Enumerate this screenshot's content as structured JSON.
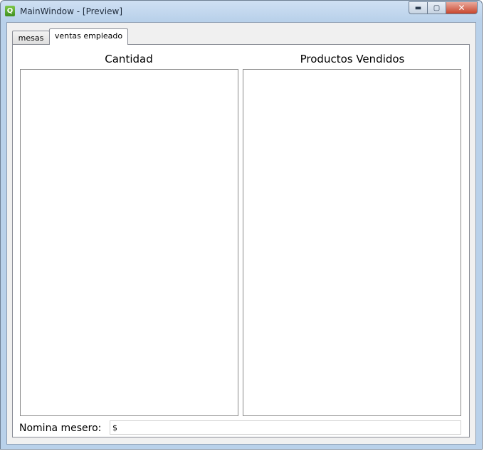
{
  "window": {
    "title": "MainWindow - [Preview]",
    "app_icon": "qt-designer-icon",
    "controls": {
      "minimize": "minimize-icon",
      "maximize": "maximize-icon",
      "close": "close-icon"
    }
  },
  "tabs": [
    {
      "label": "mesas",
      "active": false
    },
    {
      "label": "ventas empleado",
      "active": true
    }
  ],
  "panel": {
    "left_title": "Cantidad",
    "right_title": "Productos Vendidos",
    "nomina_label": "Nomina mesero:",
    "nomina_value": "$"
  }
}
